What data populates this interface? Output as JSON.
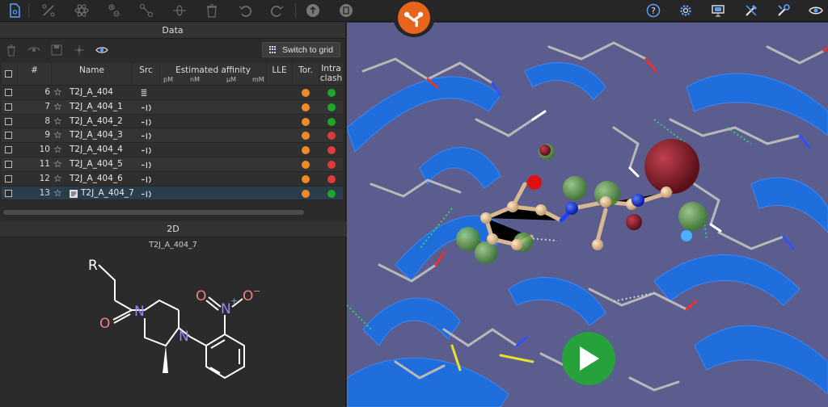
{
  "toolbar": {
    "icons_left": [
      "document-icon",
      "percent-scissors-icon",
      "atom-icon",
      "add-remove-atom-icon",
      "bond-icon",
      "bond-rotate-icon",
      "trash-icon",
      "undo-icon",
      "redo-icon",
      "upload-icon",
      "export-icon"
    ],
    "icons_right": [
      "help-icon",
      "settings-gear-icon",
      "monitor-icon",
      "tools-icon",
      "wrench-icon",
      "eye-icon"
    ]
  },
  "data_panel": {
    "title": "Data",
    "switch_button": "Switch to grid",
    "columns": {
      "num": "#",
      "name": "Name",
      "src": "Src",
      "affinity": "Estimated affinity",
      "affinity_units": [
        "pM",
        "nM",
        "µM",
        "mM"
      ],
      "lle": "LLE",
      "tor": "Tor.",
      "intra_line1": "Intra",
      "intra_line2": "clash"
    },
    "rows": [
      {
        "num": "6",
        "name": "T2J_A_404",
        "src": "sparkle",
        "tor": "#f08a24",
        "intra": "#1fa52a",
        "selected": false
      },
      {
        "num": "7",
        "name": "T2J_A_404_1",
        "src": "link",
        "tor": "#f08a24",
        "intra": "#1fa52a",
        "selected": false
      },
      {
        "num": "8",
        "name": "T2J_A_404_2",
        "src": "link",
        "tor": "#f08a24",
        "intra": "#1fa52a",
        "selected": false
      },
      {
        "num": "9",
        "name": "T2J_A_404_3",
        "src": "link",
        "tor": "#f08a24",
        "intra": "#e03c3c",
        "selected": false
      },
      {
        "num": "10",
        "name": "T2J_A_404_4",
        "src": "link",
        "tor": "#f08a24",
        "intra": "#e03c3c",
        "selected": false
      },
      {
        "num": "11",
        "name": "T2J_A_404_5",
        "src": "link",
        "tor": "#f08a24",
        "intra": "#e03c3c",
        "selected": false
      },
      {
        "num": "12",
        "name": "T2J_A_404_6",
        "src": "link",
        "tor": "#f08a24",
        "intra": "#e03c3c",
        "selected": false
      },
      {
        "num": "13",
        "name": "T2J_A_404_7",
        "src": "link",
        "tor": "#f08a24",
        "intra": "#1fa52a",
        "selected": true
      }
    ]
  },
  "panel_2d": {
    "title": "2D",
    "molecule_name": "T2J_A_404_7",
    "atoms": {
      "r": "R",
      "o_carbonyl": "O",
      "n1": "N",
      "n2": "N",
      "n_nitro": "N",
      "nitro_plus": "+",
      "o_nitro1": "O",
      "o_nitro2": "O",
      "nitro_minus": "−"
    }
  },
  "colors": {
    "accent_logo": "#e8631c",
    "play_button": "#27a13c",
    "background_3d": "#5a5d8e",
    "ribbon": "#1d6fe0"
  }
}
